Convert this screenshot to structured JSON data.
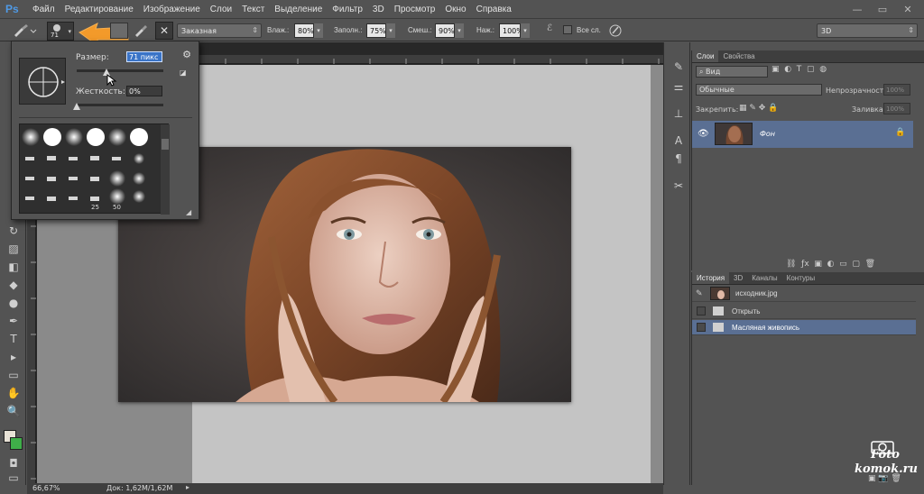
{
  "app": {
    "logo": "Ps"
  },
  "menubar": [
    "Файл",
    "Редактирование",
    "Изображение",
    "Слои",
    "Текст",
    "Выделение",
    "Фильтр",
    "3D",
    "Просмотр",
    "Окно",
    "Справка"
  ],
  "window_controls": {
    "minimize": "—",
    "restore": "▭",
    "close": "✕"
  },
  "options": {
    "brush_size": "71",
    "preset_mode": "Заказная",
    "flow_label": "Влаж.:",
    "flow_value": "80%",
    "fill_label": "Заполн.:",
    "fill_value": "75%",
    "mix_label": "Смеш.:",
    "mix_value": "90%",
    "pressure_label": "Наж.:",
    "pressure_value": "100%",
    "all_layers_label": "Все сл.",
    "workspace": "3D"
  },
  "brush_popup": {
    "size_label": "Размер:",
    "size_value": "71 пикс",
    "hardness_label": "Жесткость:",
    "hardness_value": "0%",
    "size_slider": 0.34,
    "hardness_slider": 0.0,
    "preset_numbers": [
      "25",
      "50"
    ]
  },
  "status": {
    "zoom": "66,67%",
    "doc": "Док: 1,62M/1,62M"
  },
  "layers_panel": {
    "tabs": [
      "Слои",
      "Свойства"
    ],
    "filter": "Вид",
    "blend_mode": "Обычные",
    "opacity_label": "Непрозрачность:",
    "opacity_value": "100%",
    "lock_label": "Закрепить:",
    "fill_label": "Заливка:",
    "fill_value": "100%",
    "layers": [
      {
        "name": "Фон",
        "visible": true,
        "locked": true
      }
    ]
  },
  "history_panel": {
    "tabs": [
      "История",
      "3D",
      "Каналы",
      "Контуры"
    ],
    "snapshot": "исходник.jpg",
    "items": [
      {
        "label": "Открыть",
        "selected": false
      },
      {
        "label": "Масляная живопись",
        "selected": true
      }
    ]
  },
  "watermark": {
    "line1": "Foto",
    "line2": "komok.ru"
  }
}
